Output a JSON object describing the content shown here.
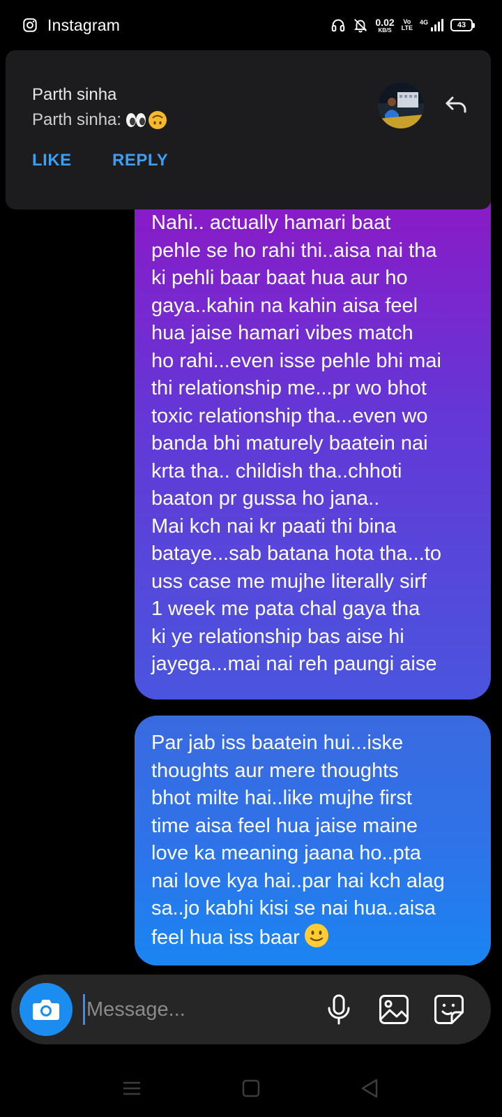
{
  "status_bar": {
    "app_name": "Instagram",
    "net_speed_value": "0.02",
    "net_speed_unit": "KB/S",
    "volte_top": "Vo",
    "volte_bottom": "LTE",
    "network_type": "4G",
    "battery": "43"
  },
  "notification": {
    "sender": "Parth sinha",
    "message_prefix": "Parth sinha:",
    "message_emojis": [
      "eyes",
      "upside-down-face"
    ],
    "like_label": "LIKE",
    "reply_label": "REPLY"
  },
  "messages": [
    {
      "lines": [
        "Nahi.. actually hamari baat",
        "pehle se ho rahi thi..aisa nai tha",
        "ki pehli baar baat hua aur ho",
        "gaya..kahin na kahin aisa feel",
        "hua jaise hamari vibes match",
        "ho rahi...even isse pehle bhi mai",
        "thi relationship me...pr wo bhot",
        "toxic relationship tha...even wo",
        "banda bhi maturely baatein nai",
        "krta tha.. childish tha..chhoti",
        "baaton pr gussa ho jana..",
        "Mai kch nai kr paati thi bina",
        "bataye...sab batana hota tha...to",
        "uss case me mujhe literally sirf",
        "1 week me pata chal gaya tha",
        "ki ye relationship bas aise hi",
        "jayega...mai nai reh paungi aise"
      ]
    },
    {
      "lines": [
        "Par jab iss baatein hui...iske",
        "thoughts aur mere thoughts",
        "bhot milte hai..like mujhe first",
        "time aisa feel hua jaise maine",
        "love ka meaning jaana ho..pta",
        "nai love kya hai..par hai kch alag",
        "sa..jo kabhi kisi se nai hua..aisa",
        "feel hua iss baar"
      ],
      "trailing_emoji": "slightly-smiling-face"
    }
  ],
  "composer": {
    "placeholder": "Message..."
  },
  "colors": {
    "accent_blue": "#3a9ff5",
    "camera_button": "#1b8cf0",
    "bubble1_top": "#8d18c6",
    "bubble1_bottom": "#4a55de",
    "bubble2_top": "#3a6ae0",
    "bubble2_bottom": "#1a85f2"
  }
}
